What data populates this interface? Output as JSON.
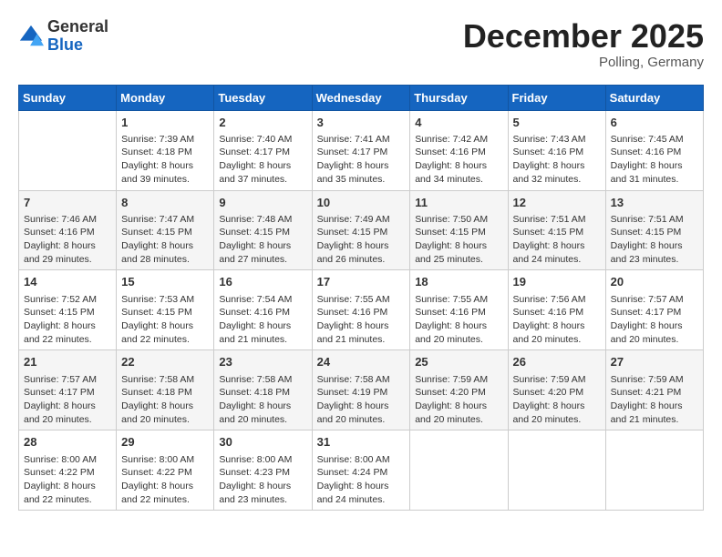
{
  "header": {
    "logo": {
      "general": "General",
      "blue": "Blue"
    },
    "title": "December 2025",
    "location": "Polling, Germany"
  },
  "weekdays": [
    "Sunday",
    "Monday",
    "Tuesday",
    "Wednesday",
    "Thursday",
    "Friday",
    "Saturday"
  ],
  "weeks": [
    [
      {
        "day": "",
        "sunrise": "",
        "sunset": "",
        "daylight": ""
      },
      {
        "day": "1",
        "sunrise": "Sunrise: 7:39 AM",
        "sunset": "Sunset: 4:18 PM",
        "daylight": "Daylight: 8 hours and 39 minutes."
      },
      {
        "day": "2",
        "sunrise": "Sunrise: 7:40 AM",
        "sunset": "Sunset: 4:17 PM",
        "daylight": "Daylight: 8 hours and 37 minutes."
      },
      {
        "day": "3",
        "sunrise": "Sunrise: 7:41 AM",
        "sunset": "Sunset: 4:17 PM",
        "daylight": "Daylight: 8 hours and 35 minutes."
      },
      {
        "day": "4",
        "sunrise": "Sunrise: 7:42 AM",
        "sunset": "Sunset: 4:16 PM",
        "daylight": "Daylight: 8 hours and 34 minutes."
      },
      {
        "day": "5",
        "sunrise": "Sunrise: 7:43 AM",
        "sunset": "Sunset: 4:16 PM",
        "daylight": "Daylight: 8 hours and 32 minutes."
      },
      {
        "day": "6",
        "sunrise": "Sunrise: 7:45 AM",
        "sunset": "Sunset: 4:16 PM",
        "daylight": "Daylight: 8 hours and 31 minutes."
      }
    ],
    [
      {
        "day": "7",
        "sunrise": "Sunrise: 7:46 AM",
        "sunset": "Sunset: 4:16 PM",
        "daylight": "Daylight: 8 hours and 29 minutes."
      },
      {
        "day": "8",
        "sunrise": "Sunrise: 7:47 AM",
        "sunset": "Sunset: 4:15 PM",
        "daylight": "Daylight: 8 hours and 28 minutes."
      },
      {
        "day": "9",
        "sunrise": "Sunrise: 7:48 AM",
        "sunset": "Sunset: 4:15 PM",
        "daylight": "Daylight: 8 hours and 27 minutes."
      },
      {
        "day": "10",
        "sunrise": "Sunrise: 7:49 AM",
        "sunset": "Sunset: 4:15 PM",
        "daylight": "Daylight: 8 hours and 26 minutes."
      },
      {
        "day": "11",
        "sunrise": "Sunrise: 7:50 AM",
        "sunset": "Sunset: 4:15 PM",
        "daylight": "Daylight: 8 hours and 25 minutes."
      },
      {
        "day": "12",
        "sunrise": "Sunrise: 7:51 AM",
        "sunset": "Sunset: 4:15 PM",
        "daylight": "Daylight: 8 hours and 24 minutes."
      },
      {
        "day": "13",
        "sunrise": "Sunrise: 7:51 AM",
        "sunset": "Sunset: 4:15 PM",
        "daylight": "Daylight: 8 hours and 23 minutes."
      }
    ],
    [
      {
        "day": "14",
        "sunrise": "Sunrise: 7:52 AM",
        "sunset": "Sunset: 4:15 PM",
        "daylight": "Daylight: 8 hours and 22 minutes."
      },
      {
        "day": "15",
        "sunrise": "Sunrise: 7:53 AM",
        "sunset": "Sunset: 4:15 PM",
        "daylight": "Daylight: 8 hours and 22 minutes."
      },
      {
        "day": "16",
        "sunrise": "Sunrise: 7:54 AM",
        "sunset": "Sunset: 4:16 PM",
        "daylight": "Daylight: 8 hours and 21 minutes."
      },
      {
        "day": "17",
        "sunrise": "Sunrise: 7:55 AM",
        "sunset": "Sunset: 4:16 PM",
        "daylight": "Daylight: 8 hours and 21 minutes."
      },
      {
        "day": "18",
        "sunrise": "Sunrise: 7:55 AM",
        "sunset": "Sunset: 4:16 PM",
        "daylight": "Daylight: 8 hours and 20 minutes."
      },
      {
        "day": "19",
        "sunrise": "Sunrise: 7:56 AM",
        "sunset": "Sunset: 4:16 PM",
        "daylight": "Daylight: 8 hours and 20 minutes."
      },
      {
        "day": "20",
        "sunrise": "Sunrise: 7:57 AM",
        "sunset": "Sunset: 4:17 PM",
        "daylight": "Daylight: 8 hours and 20 minutes."
      }
    ],
    [
      {
        "day": "21",
        "sunrise": "Sunrise: 7:57 AM",
        "sunset": "Sunset: 4:17 PM",
        "daylight": "Daylight: 8 hours and 20 minutes."
      },
      {
        "day": "22",
        "sunrise": "Sunrise: 7:58 AM",
        "sunset": "Sunset: 4:18 PM",
        "daylight": "Daylight: 8 hours and 20 minutes."
      },
      {
        "day": "23",
        "sunrise": "Sunrise: 7:58 AM",
        "sunset": "Sunset: 4:18 PM",
        "daylight": "Daylight: 8 hours and 20 minutes."
      },
      {
        "day": "24",
        "sunrise": "Sunrise: 7:58 AM",
        "sunset": "Sunset: 4:19 PM",
        "daylight": "Daylight: 8 hours and 20 minutes."
      },
      {
        "day": "25",
        "sunrise": "Sunrise: 7:59 AM",
        "sunset": "Sunset: 4:20 PM",
        "daylight": "Daylight: 8 hours and 20 minutes."
      },
      {
        "day": "26",
        "sunrise": "Sunrise: 7:59 AM",
        "sunset": "Sunset: 4:20 PM",
        "daylight": "Daylight: 8 hours and 20 minutes."
      },
      {
        "day": "27",
        "sunrise": "Sunrise: 7:59 AM",
        "sunset": "Sunset: 4:21 PM",
        "daylight": "Daylight: 8 hours and 21 minutes."
      }
    ],
    [
      {
        "day": "28",
        "sunrise": "Sunrise: 8:00 AM",
        "sunset": "Sunset: 4:22 PM",
        "daylight": "Daylight: 8 hours and 22 minutes."
      },
      {
        "day": "29",
        "sunrise": "Sunrise: 8:00 AM",
        "sunset": "Sunset: 4:22 PM",
        "daylight": "Daylight: 8 hours and 22 minutes."
      },
      {
        "day": "30",
        "sunrise": "Sunrise: 8:00 AM",
        "sunset": "Sunset: 4:23 PM",
        "daylight": "Daylight: 8 hours and 23 minutes."
      },
      {
        "day": "31",
        "sunrise": "Sunrise: 8:00 AM",
        "sunset": "Sunset: 4:24 PM",
        "daylight": "Daylight: 8 hours and 24 minutes."
      },
      {
        "day": "",
        "sunrise": "",
        "sunset": "",
        "daylight": ""
      },
      {
        "day": "",
        "sunrise": "",
        "sunset": "",
        "daylight": ""
      },
      {
        "day": "",
        "sunrise": "",
        "sunset": "",
        "daylight": ""
      }
    ]
  ],
  "colors": {
    "header_bg": "#1565c0",
    "row_alt": "#f5f5f5",
    "row_white": "#ffffff"
  }
}
